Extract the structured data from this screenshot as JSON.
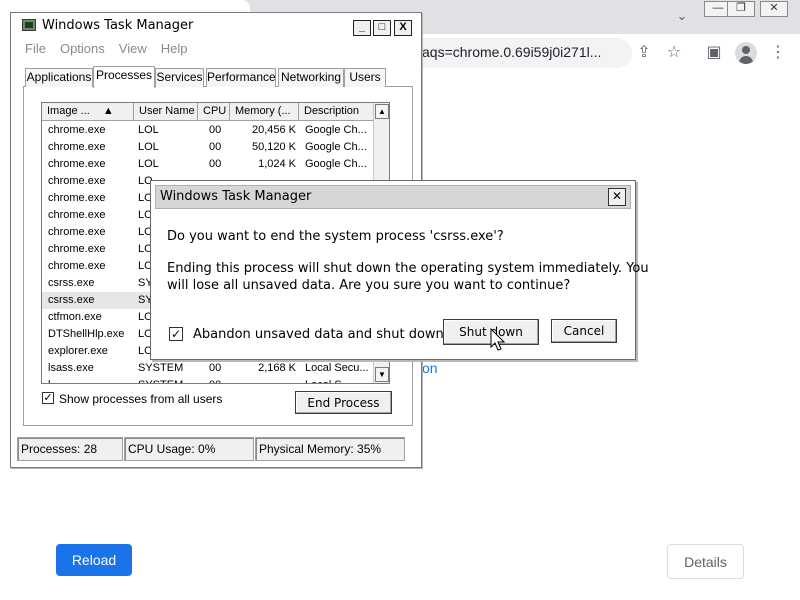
{
  "browser": {
    "address_fragment": "aqs=chrome.0.69i59j0i271l...",
    "window_controls": [
      "—",
      "❐",
      "✕"
    ],
    "page_link_fragment": "on",
    "reload_label": "Reload",
    "details_label": "Details",
    "accent_color": "#1a73e8"
  },
  "task_manager": {
    "title": "Windows Task Manager",
    "title_buttons": [
      "_",
      "□",
      "X"
    ],
    "menu": [
      "File",
      "Options",
      "View",
      "Help"
    ],
    "tabs": [
      "Applications",
      "Processes",
      "Services",
      "Performance",
      "Networking",
      "Users"
    ],
    "active_tab": "Processes",
    "columns": [
      "Image ...",
      "User Name",
      "CPU",
      "Memory (...",
      "Description"
    ],
    "sort_indicator": "▲",
    "rows": [
      {
        "image": "chrome.exe",
        "user": "LOL",
        "cpu": "00",
        "memory": "20,456 K",
        "description": "Google Ch..."
      },
      {
        "image": "chrome.exe",
        "user": "LOL",
        "cpu": "00",
        "memory": "50,120 K",
        "description": "Google Ch..."
      },
      {
        "image": "chrome.exe",
        "user": "LOL",
        "cpu": "00",
        "memory": "1,024 K",
        "description": "Google Ch..."
      },
      {
        "image": "chrome.exe",
        "user": "LO",
        "cpu": "",
        "memory": "",
        "description": ""
      },
      {
        "image": "chrome.exe",
        "user": "LO",
        "cpu": "",
        "memory": "",
        "description": ""
      },
      {
        "image": "chrome.exe",
        "user": "LO",
        "cpu": "",
        "memory": "",
        "description": ""
      },
      {
        "image": "chrome.exe",
        "user": "LO",
        "cpu": "",
        "memory": "",
        "description": ""
      },
      {
        "image": "chrome.exe",
        "user": "LO",
        "cpu": "",
        "memory": "",
        "description": ""
      },
      {
        "image": "chrome.exe",
        "user": "LO",
        "cpu": "",
        "memory": "",
        "description": ""
      },
      {
        "image": "csrss.exe",
        "user": "SY",
        "cpu": "",
        "memory": "",
        "description": ""
      },
      {
        "image": "csrss.exe",
        "user": "SY",
        "cpu": "",
        "memory": "",
        "description": ""
      },
      {
        "image": "ctfmon.exe",
        "user": "LO",
        "cpu": "",
        "memory": "",
        "description": ""
      },
      {
        "image": "DTShellHlp.exe",
        "user": "LO",
        "cpu": "",
        "memory": "",
        "description": ""
      },
      {
        "image": "explorer.exe",
        "user": "LO",
        "cpu": "",
        "memory": "",
        "description": ""
      },
      {
        "image": "lsass.exe",
        "user": "SYSTEM",
        "cpu": "00",
        "memory": "2,168 K",
        "description": "Local Secu..."
      },
      {
        "image": "l...",
        "user": "SYSTEM",
        "cpu": "00",
        "memory": "...",
        "description": "Local S..."
      }
    ],
    "selected_row": 10,
    "show_all_label": "Show processes from all users",
    "show_all_checked": true,
    "end_process_label": "End Process",
    "status": {
      "processes": "Processes: 28",
      "cpu": "CPU Usage: 0%",
      "memory": "Physical Memory: 35%"
    }
  },
  "dialog": {
    "title": "Windows Task Manager",
    "close_glyph": "✕",
    "question": "Do you want to end the system process 'csrss.exe'?",
    "warning_line1": "Ending this process will shut down the operating system immediately.  You",
    "warning_line2": "will lose all unsaved data.  Are you sure you want to continue?",
    "abandon_label": "Abandon unsaved data and shut down.",
    "abandon_checked": true,
    "shutdown_label": "Shut down",
    "cancel_label": "Cancel"
  }
}
